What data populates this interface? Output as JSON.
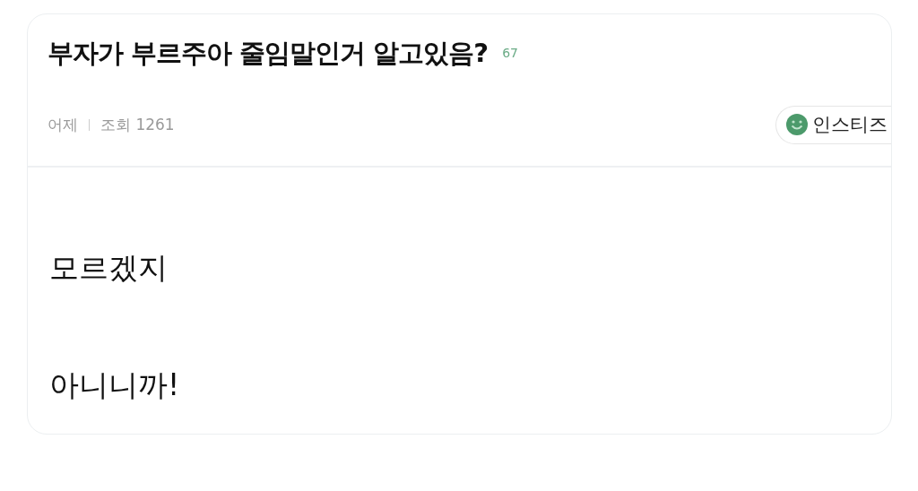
{
  "post": {
    "title": "부자가 부르주아 줄임말인거 알고있음?",
    "comment_count": "67",
    "date": "어제",
    "views_label": "조회",
    "views": "1261",
    "source": "인스티즈",
    "body": [
      "모르겠지",
      "아니니까!"
    ]
  }
}
